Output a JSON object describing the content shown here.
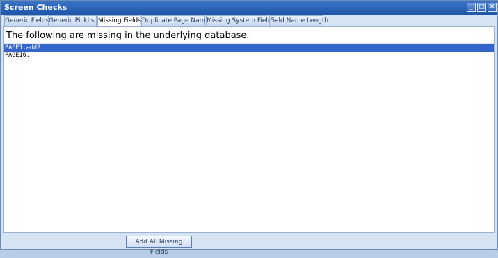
{
  "window": {
    "title": "Screen Checks",
    "controls": {
      "minimize_glyph": "_",
      "maximize_glyph": "□",
      "close_glyph": "✕"
    }
  },
  "tabs": [
    {
      "label": "Generic Fields",
      "active": false
    },
    {
      "label": "Generic Picklists",
      "active": false
    },
    {
      "label": "Missing Fields",
      "active": true
    },
    {
      "label": "Duplicate Page Names",
      "active": false
    },
    {
      "label": "Missing System Fields",
      "active": false
    },
    {
      "label": "Field Name Length",
      "active": false
    }
  ],
  "panel": {
    "heading": "The following are missing in the underlying database.",
    "items": [
      {
        "text": "PAGE1.add2",
        "selected": true
      },
      {
        "text": "PAGE16.",
        "selected": false
      }
    ]
  },
  "footer": {
    "add_button_label": "Add All Missing Fields"
  },
  "colors": {
    "title_bar": "#1d55a8",
    "selection": "#3366cc",
    "window_bg": "#d6e3f3"
  }
}
